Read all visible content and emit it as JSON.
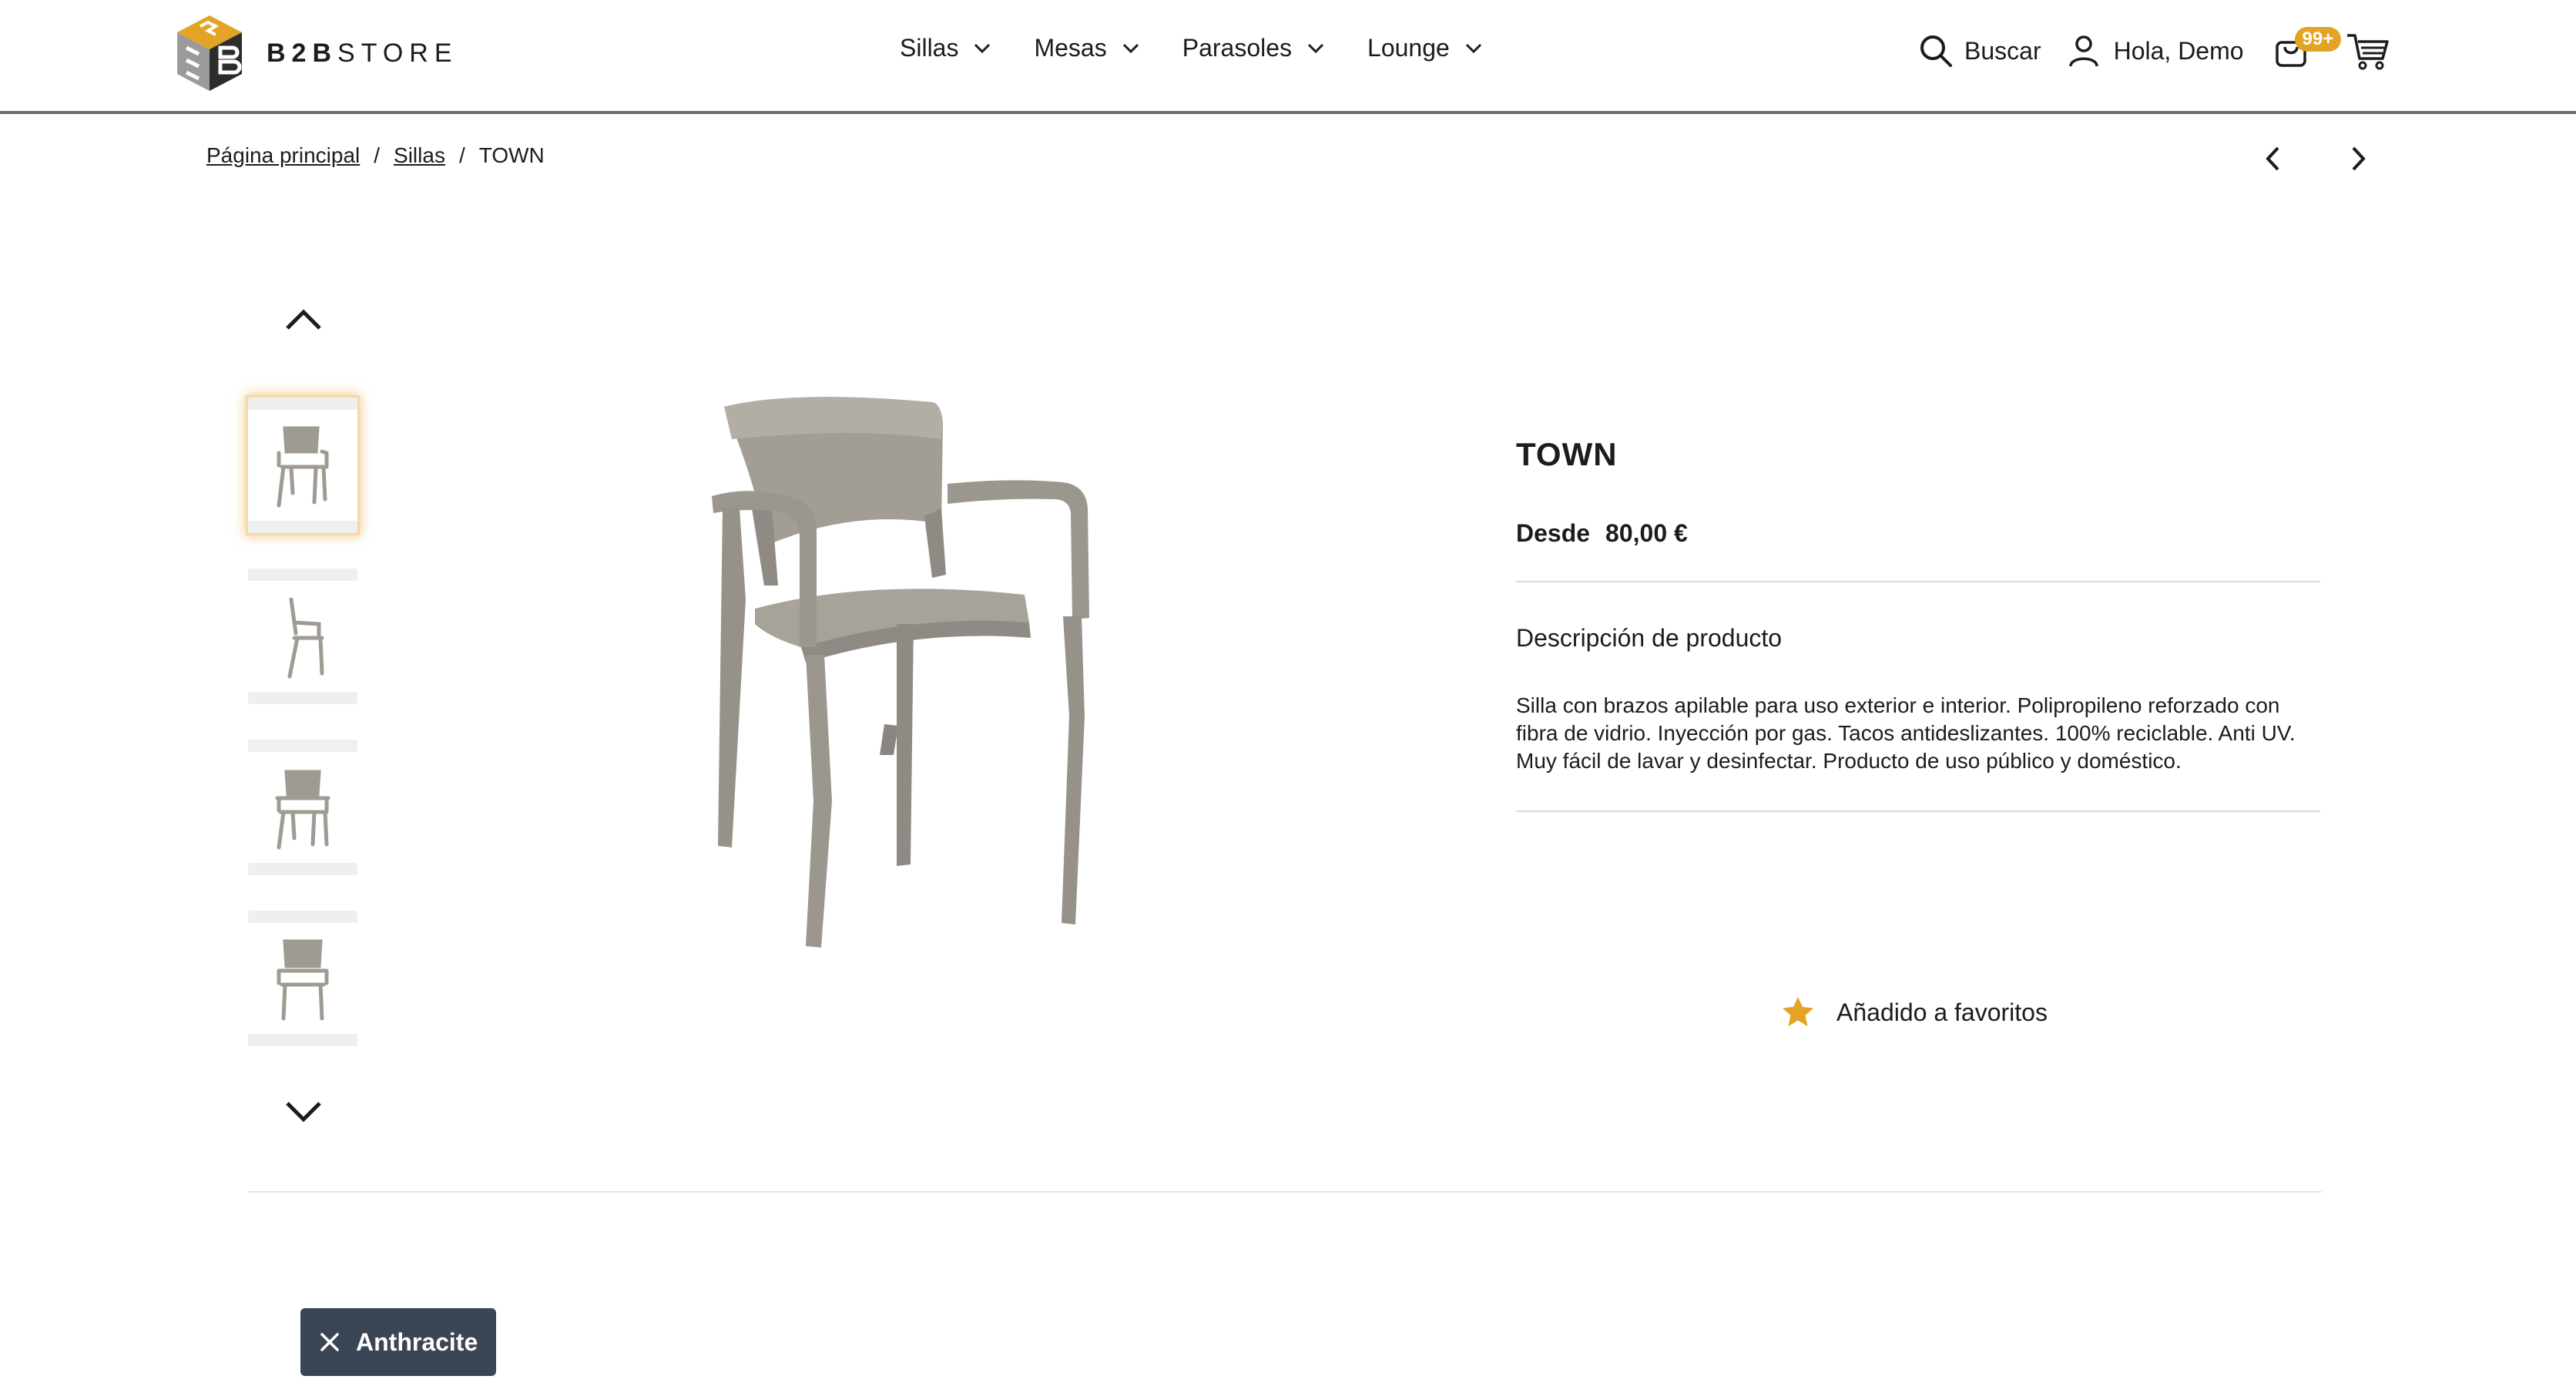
{
  "brand": {
    "bold": "B2B",
    "light": "STORE",
    "colors": {
      "yellow": "#e3a324",
      "gray": "#9b9b9b",
      "dark": "#2d2d2d"
    }
  },
  "nav": {
    "items": [
      {
        "label": "Sillas",
        "icon": "chevron-down-icon"
      },
      {
        "label": "Mesas",
        "icon": "chevron-down-icon"
      },
      {
        "label": "Parasoles",
        "icon": "chevron-down-icon"
      },
      {
        "label": "Lounge",
        "icon": "chevron-down-icon"
      }
    ]
  },
  "header": {
    "search_label": "Buscar",
    "user_greeting": "Hola, Demo",
    "bag_badge": "99+",
    "badge_color": "#e3a324"
  },
  "breadcrumb": {
    "home": "Página principal",
    "category": "Sillas",
    "current": "TOWN",
    "separator": "/"
  },
  "gallery": {
    "thumbnail_count": 4,
    "active_index": 0,
    "product_color": "#9f9a92"
  },
  "product": {
    "title": "TOWN",
    "price_prefix": "Desde",
    "price": "80,00 €",
    "description_heading": "Descripción de producto",
    "description": "Silla con brazos apilable para uso exterior e interior. Polipropileno reforzado con fibra de vidrio. Inyección por gas. Tacos antideslizantes. 100% reciclable. Anti UV. Muy fácil de lavar y desinfectar. Producto de uso público y doméstico.",
    "favorite_label": "Añadido a favoritos",
    "favorite_color": "#e3a324"
  },
  "filter_chip": {
    "label": "Anthracite",
    "background": "#3a4656"
  }
}
